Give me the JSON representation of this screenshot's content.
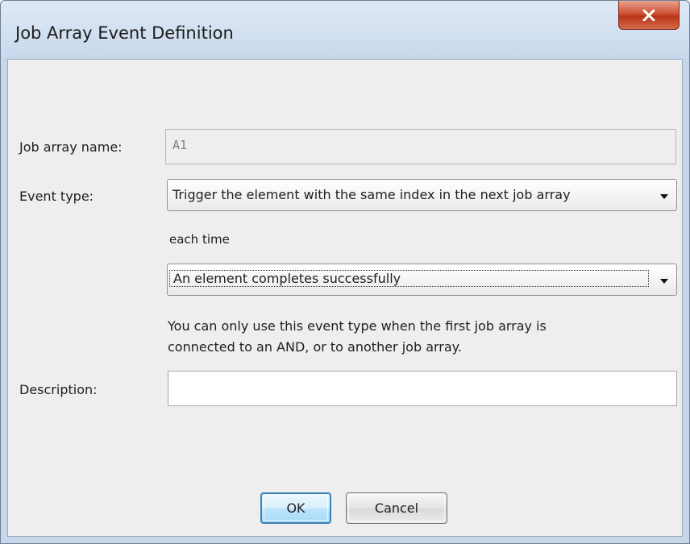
{
  "window": {
    "title": "Job Array Event Definition",
    "close_glyph": "X",
    "close_icon": "close-icon"
  },
  "form": {
    "job_array_name": {
      "label": "Job array name:",
      "value": "A1"
    },
    "event_type": {
      "label": "Event type:",
      "selected": "Trigger the element with the same index in the next job array",
      "arrow_icon": "chevron-down-icon"
    },
    "each_time_label": "each time",
    "condition": {
      "selected": "An element completes successfully",
      "arrow_icon": "chevron-down-icon"
    },
    "info_line1": "You can only use this event type when the first job array is",
    "info_line2": "connected to an AND, or to another job array.",
    "description": {
      "label": "Description:",
      "value": ""
    }
  },
  "buttons": {
    "ok": "OK",
    "cancel": "Cancel"
  },
  "colors": {
    "close_button": "#c9452a",
    "default_button_border": "#3c7fb1",
    "window_frame": "#c7d6e8"
  }
}
